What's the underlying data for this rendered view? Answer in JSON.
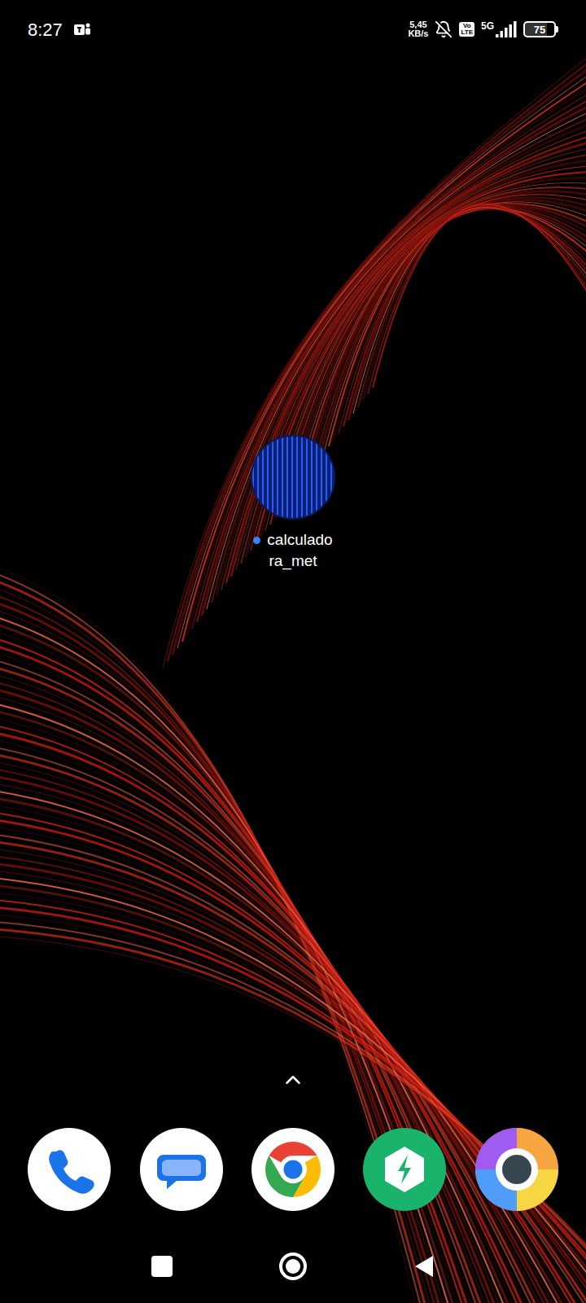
{
  "status_bar": {
    "time": "8:27",
    "net_speed": {
      "value": "5,45",
      "unit": "KB/s"
    },
    "notifications_muted": true,
    "volte": {
      "top": "Vo",
      "bottom": "LTE"
    },
    "network": "5G",
    "signal_level": 1,
    "battery": {
      "text": "75",
      "level": 0.75
    }
  },
  "home": {
    "apps": [
      {
        "label_lines": [
          "calculado",
          "ra_met"
        ],
        "new": true,
        "dot_color": "#3b82f6"
      }
    ]
  },
  "dock": [
    {
      "kind": "phone"
    },
    {
      "kind": "messages"
    },
    {
      "kind": "chrome"
    },
    {
      "kind": "manager"
    },
    {
      "kind": "browser"
    }
  ]
}
